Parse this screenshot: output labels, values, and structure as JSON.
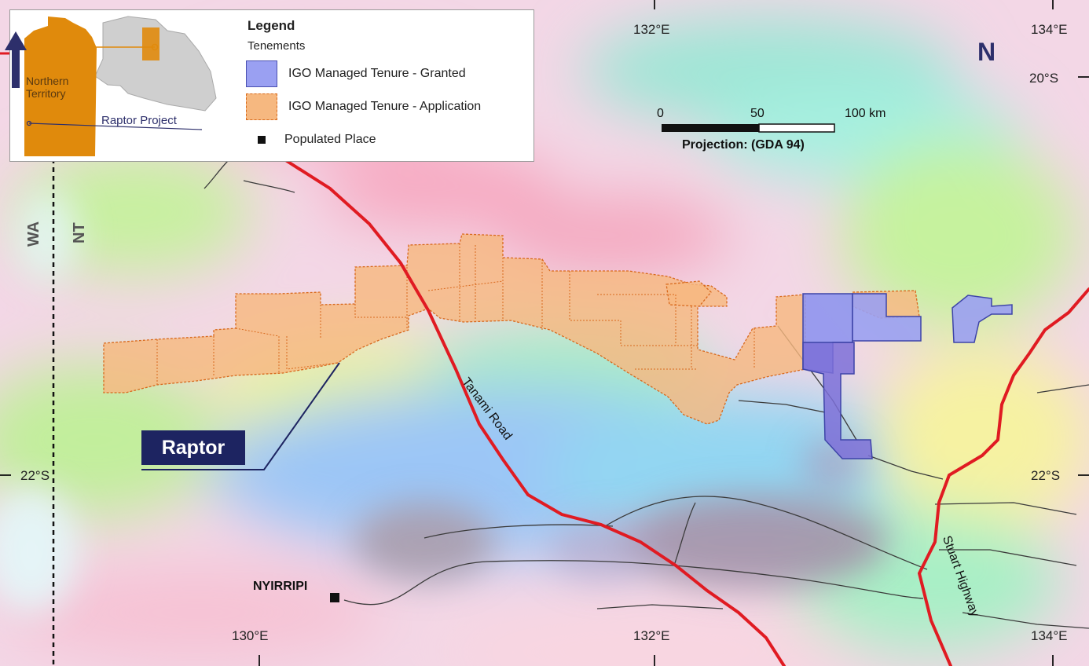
{
  "legend": {
    "title": "Legend",
    "subtitle": "Tenements",
    "items": [
      {
        "label": "IGO Managed Tenure - Granted",
        "color": "#9aa0f2"
      },
      {
        "label": "IGO Managed Tenure - Application",
        "color": "#f6b880"
      },
      {
        "label": "Populated Place",
        "color": "#111111"
      }
    ]
  },
  "inset": {
    "region_label": "Northern Territory",
    "project_label": "Raptor Project",
    "region_color": "#e08a0c",
    "country_color": "#cfcfcf"
  },
  "north_arrow": {
    "label": "N",
    "color": "#2d2f6b"
  },
  "scale_bar": {
    "ticks": [
      "0",
      "50",
      "100 km"
    ],
    "projection": "Projection: (GDA 94)"
  },
  "graticule": {
    "lon_labels": [
      "132°E",
      "134°E",
      "130°E",
      "132°E",
      "134°E"
    ],
    "lat_labels": [
      "20°S",
      "22°S",
      "22°S"
    ]
  },
  "borders": {
    "west": "WA",
    "east": "NT"
  },
  "roads": {
    "tanami": "Tanami Road",
    "stuart": "Stuart Highway",
    "color": "#e01b22"
  },
  "places": {
    "nyirripi": "NYIRRIPI"
  },
  "project": {
    "callout": "Raptor",
    "callout_color": "#1d2461"
  }
}
